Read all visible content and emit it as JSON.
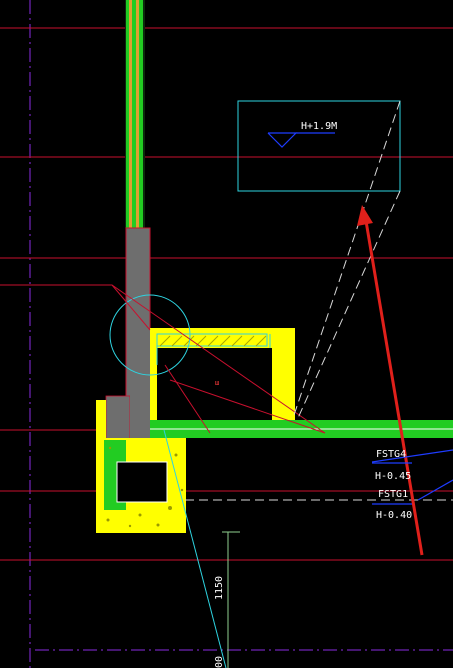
{
  "drawing": {
    "background": "#000000",
    "colors": {
      "red_line": "#c8102e",
      "purple_line": "#8a2be2",
      "cyan_line": "#2ed3e0",
      "yellow_fill": "#ffff00",
      "green_fill": "#22cc22",
      "grey_fill": "#6e6e6e",
      "blue_line": "#1e3cff",
      "annotation_arrow": "#e0201b",
      "white": "#ffffff"
    },
    "annotations": {
      "elevation_mark": "H+1.9M",
      "label_fstg4": "FSTG4",
      "label_h045": "H-0.45",
      "label_fstg1": "FSTG1",
      "label_h040": "H-0.40",
      "dimension": "1150",
      "dimension_partial": "00",
      "small_red_text": "ш"
    }
  }
}
